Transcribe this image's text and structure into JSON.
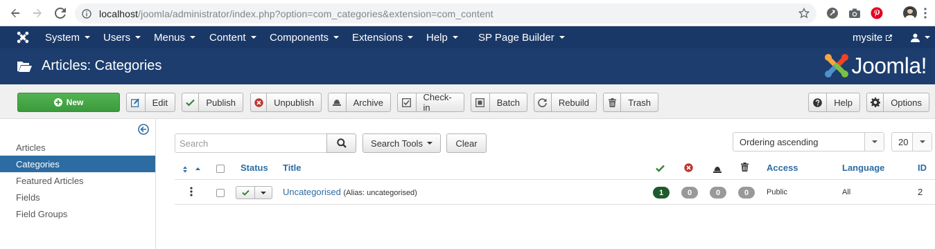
{
  "browser": {
    "url_host": "localhost",
    "url_path": "/joomla/administrator/index.php?option=com_categories&extension=com_content"
  },
  "topbar": {
    "menu": [
      "System",
      "Users",
      "Menus",
      "Content",
      "Components",
      "Extensions",
      "Help",
      "SP Page Builder"
    ],
    "site_label": "mysite"
  },
  "header": {
    "title": "Articles: Categories",
    "logo_text": "Joomla!"
  },
  "toolbar": {
    "new": "New",
    "edit": "Edit",
    "publish": "Publish",
    "unpublish": "Unpublish",
    "archive": "Archive",
    "checkin": "Check-in",
    "batch": "Batch",
    "rebuild": "Rebuild",
    "trash": "Trash",
    "help": "Help",
    "options": "Options"
  },
  "sidebar": {
    "items": [
      "Articles",
      "Categories",
      "Featured Articles",
      "Fields",
      "Field Groups"
    ],
    "active": "Categories"
  },
  "filters": {
    "search_placeholder": "Search",
    "search_tools": "Search Tools",
    "clear": "Clear",
    "ordering": "Ordering ascending",
    "limit": "20"
  },
  "table": {
    "headers": {
      "status": "Status",
      "title": "Title",
      "access": "Access",
      "language": "Language",
      "id": "ID"
    },
    "rows": [
      {
        "title": "Uncategorised",
        "alias": "(Alias: uncategorised)",
        "published": "1",
        "unpublished": "0",
        "archived": "0",
        "trashed": "0",
        "access": "Public",
        "language": "All",
        "id": "2"
      }
    ]
  },
  "colors": {
    "topbar": "#1a3867",
    "header": "#1c3d6e",
    "accent": "#2d6ca2",
    "new_button": "#46a546",
    "published_badge": "#1e5a2c",
    "zero_badge": "#999999"
  }
}
